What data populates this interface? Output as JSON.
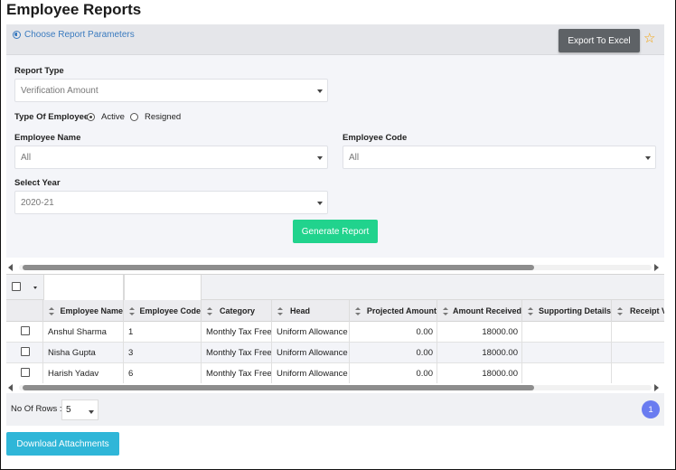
{
  "page": {
    "title": "Employee Reports"
  },
  "params_bar": {
    "link_label": "Choose Report Parameters",
    "export_label": "Export To Excel",
    "star_icon": "star-icon"
  },
  "form": {
    "report_type": {
      "label": "Report Type",
      "value": "Verification Amount"
    },
    "type_of_employees": {
      "label": "Type Of Employees",
      "options": [
        "Active",
        "Resigned"
      ],
      "selected": "Active"
    },
    "employee_name": {
      "label": "Employee Name",
      "value": "All"
    },
    "employee_code": {
      "label": "Employee Code",
      "value": "All"
    },
    "select_year": {
      "label": "Select Year",
      "value": "2020-21"
    },
    "generate_label": "Generate Report"
  },
  "table": {
    "columns": [
      "Employee Name",
      "Employee Code",
      "Category",
      "Head",
      "Projected Amount",
      "Amount Received",
      "Supporting Details",
      "Receipt V"
    ],
    "rows": [
      [
        "Anshul Sharma",
        "1",
        "Monthly Tax Free",
        "Uniform Allowance",
        "0.00",
        "18000.00",
        "",
        ""
      ],
      [
        "Nisha Gupta",
        "3",
        "Monthly Tax Free",
        "Uniform Allowance",
        "0.00",
        "18000.00",
        "",
        ""
      ],
      [
        "Harish Yadav",
        "6",
        "Monthly Tax Free",
        "Uniform Allowance",
        "0.00",
        "18000.00",
        "",
        ""
      ]
    ]
  },
  "pager": {
    "rows_label": "No Of Rows :",
    "rows_value": "5",
    "current_page": "1"
  },
  "download_label": "Download Attachments",
  "colors": {
    "accent_green": "#21d38d",
    "accent_blue": "#2fb6d8",
    "export_grey": "#5e6266",
    "page_badge": "#6a7cf0",
    "link": "#3b7bbf",
    "star": "#f5a200"
  }
}
